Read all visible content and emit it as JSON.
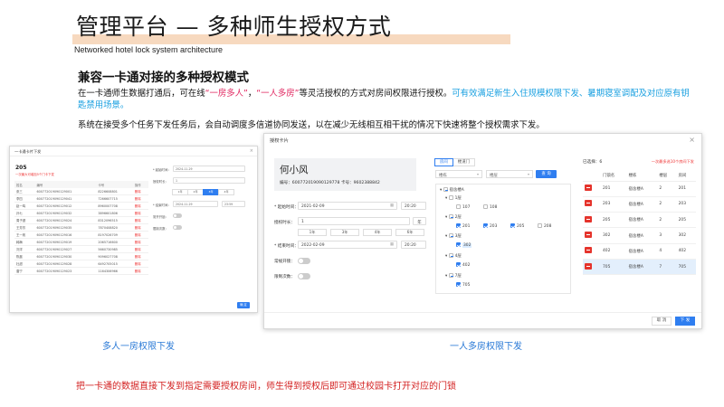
{
  "slide": {
    "title": "管理平台 — 多种师生授权方式",
    "subtitle": "Networked hotel lock system architecture",
    "section_title": "兼容一卡通对接的多种授权模式",
    "para1_a": "在一卡通师生数据打通后，可在线",
    "para1_q1": "“一房多人”",
    "para1_sep": "，",
    "para1_q2": "“一人多房”",
    "para1_b": "等灵活授权的方式对房间权限进行授权。",
    "para1_blue": "可有效满足新生入住规模权限下发、暑期寝室调配及对应原有钥匙禁用场景。",
    "para2": "系统在接受多个任务下发任务后，会自动调度多信道协同发送，以在减少无线相互相干扰的情况下快速将整个授权需求下发。",
    "caption_left": "多人一房权限下发",
    "caption_right": "一人多房权限下发",
    "footer_note": "把一卡通的数据直接下发到指定需要授权房间，师生得到授权后即可通过校园卡打开对应的门锁"
  },
  "small_dialog": {
    "title": "一卡通卡片下发",
    "close": "×",
    "room": "205",
    "warn": "一次最大可增加5个门卡下发",
    "table": {
      "headers": [
        "姓名",
        "编号",
        "卡号",
        "操作"
      ],
      "rows": [
        {
          "name": "张三",
          "id": "600772019090129001",
          "card": "8226608801",
          "op": "删除"
        },
        {
          "name": "李四",
          "id": "600772019090129041",
          "card": "7266607715",
          "op": "删除"
        },
        {
          "name": "赵一鸣",
          "id": "600772019090129012",
          "card": "8960007708",
          "op": "删除"
        },
        {
          "name": "孙七",
          "id": "600772019090129032",
          "card": "3896601806",
          "op": "删除"
        },
        {
          "name": "周子健",
          "id": "600772019090129024",
          "card": "8312096515",
          "op": "删除"
        },
        {
          "name": "王芳芳",
          "id": "600772019090129035",
          "card": "7870408820",
          "op": "删除"
        },
        {
          "name": "王一帆",
          "id": "600772019090129016",
          "card": "8197026709",
          "op": "删除"
        },
        {
          "name": "韩梅",
          "id": "600772019090129019",
          "card": "2065716600",
          "op": "删除"
        },
        {
          "name": "刘洋",
          "id": "600772019090129027",
          "card": "5660730985",
          "op": "删除"
        },
        {
          "name": "陈晨",
          "id": "600772019090129030",
          "card": "9096027708",
          "op": "删除"
        },
        {
          "name": "杜甜",
          "id": "600772019090129028",
          "card": "6492705015",
          "op": "删除"
        },
        {
          "name": "唐宁",
          "id": "600772019090129023",
          "card": "1164306966",
          "op": "删除"
        }
      ]
    },
    "form": {
      "start_label": "* 起始时间：",
      "start_value": "2024-11-29",
      "period_label": "授权时长：",
      "period_value": "1",
      "seg": [
        "1年",
        "2年",
        "3年",
        "4年"
      ],
      "end_label": "* 结束时间：",
      "end_value": "2024-11-29",
      "end_time": "23:59",
      "toggle1_label": "常开开锁：",
      "toggle2_label": "限制次数："
    },
    "ok": "确 定"
  },
  "big_dialog": {
    "title": "授权卡片",
    "close": "×",
    "person_name": "何小风",
    "person_meta": "编号：600772019090129778  卡号：9602388842",
    "start_label": "* 起始时间：",
    "start_value": "2021-02-09",
    "start_time": "20:20",
    "period_label": "授权时长：",
    "period_value": "1",
    "period_unit": "年",
    "periods": [
      "1年",
      "3年",
      "4年",
      "6年"
    ],
    "end_label": "* 结束时间：",
    "end_value": "2022-02-09",
    "end_time": "20:20",
    "toggle1_label": "常规开锁：",
    "toggle2_label": "限制次数：",
    "tabs": [
      "房间",
      "楼道门"
    ],
    "building_placeholder": "楼栋",
    "floor_placeholder": "楼层",
    "query": "查 询",
    "tree": {
      "root": "宿舍楼A",
      "floor1": "1层",
      "r107": "107",
      "r108": "108",
      "floor2": "2层",
      "r201": "201",
      "r203": "203",
      "r205": "205",
      "r208": "208",
      "floor3": "3层",
      "r302": "302",
      "floor4": "4层",
      "r402": "402",
      "floor7": "7层",
      "r705": "705"
    },
    "selected_count": "已选择：6",
    "limit_note": "一次最多选10个房间下发",
    "table_headers": [
      "",
      "门锁名",
      "楼栋",
      "楼层",
      "房间"
    ],
    "rows": [
      {
        "lock": "201",
        "bldg": "宿舍楼A",
        "floor": "2",
        "room": "201"
      },
      {
        "lock": "203",
        "bldg": "宿舍楼A",
        "floor": "2",
        "room": "203"
      },
      {
        "lock": "205",
        "bldg": "宿舍楼A",
        "floor": "2",
        "room": "205"
      },
      {
        "lock": "302",
        "bldg": "宿舍楼A",
        "floor": "3",
        "room": "302"
      },
      {
        "lock": "402",
        "bldg": "宿舍楼A",
        "floor": "4",
        "room": "402"
      },
      {
        "lock": "705",
        "bldg": "宿舍楼A",
        "floor": "7",
        "room": "705"
      }
    ],
    "cancel": "取 消",
    "ok": "下 发"
  }
}
